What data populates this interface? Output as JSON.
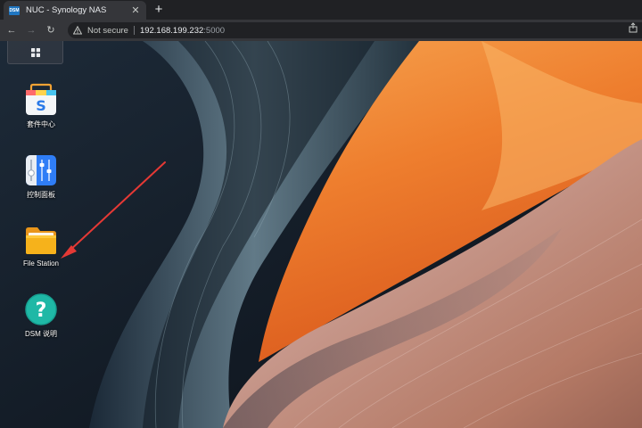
{
  "browser": {
    "tab": {
      "favicon_text": "DSM",
      "title": "NUC - Synology NAS",
      "close_glyph": "✕"
    },
    "new_tab_glyph": "+",
    "nav": {
      "back_glyph": "←",
      "forward_glyph": "→",
      "reload_glyph": "↻"
    },
    "address": {
      "security_label": "Not secure",
      "host": "192.168.199.232",
      "port": ":5000"
    }
  },
  "desktop": {
    "launcher_icon": "grid-icon",
    "apps": [
      {
        "label": "套件中心",
        "icon": "package-center-icon"
      },
      {
        "label": "控制面板",
        "icon": "control-panel-icon"
      },
      {
        "label": "File Station",
        "icon": "folder-icon"
      },
      {
        "label": "DSM 说明",
        "icon": "help-icon"
      }
    ]
  },
  "colors": {
    "chrome_dark": "#202124",
    "chrome_toolbar": "#35363a",
    "arrow": "#e53935",
    "folder": "#f6b21b",
    "help": "#1fb8a6",
    "control_panel": "#2f7df6"
  }
}
